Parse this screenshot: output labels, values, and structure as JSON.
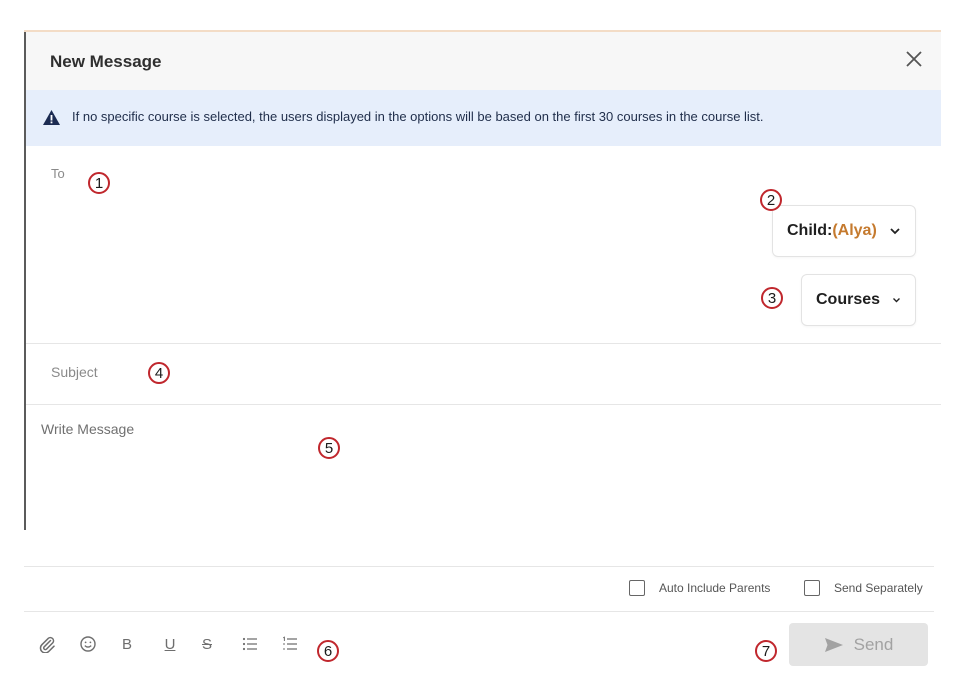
{
  "dialog": {
    "title": "New Message",
    "info_text": "If no specific course is selected, the users displayed in the options will be based on the first 30 courses in the course list."
  },
  "fields": {
    "to_label": "To",
    "subject_placeholder": "Subject",
    "message_placeholder": "Write Message"
  },
  "dropdowns": {
    "child_prefix": "Child:",
    "child_value": "(Alya)",
    "courses": "Courses"
  },
  "options": {
    "auto_include_parents": "Auto Include Parents",
    "send_separately": "Send Separately"
  },
  "toolbar": {
    "bold": "B",
    "underline": "U",
    "strike": "S",
    "icons": [
      "paperclip-icon",
      "emoji-icon",
      "bold-icon",
      "underline-icon",
      "strikethrough-icon",
      "bullet-list-icon",
      "numbered-list-icon"
    ]
  },
  "send": {
    "label": "Send"
  },
  "markers": [
    "1",
    "2",
    "3",
    "4",
    "5",
    "6",
    "7"
  ],
  "colors": {
    "accent": "#c57a2e",
    "info_bg": "#e6eefb",
    "marker": "#c0272d",
    "send_disabled": "#e4e4e4"
  }
}
